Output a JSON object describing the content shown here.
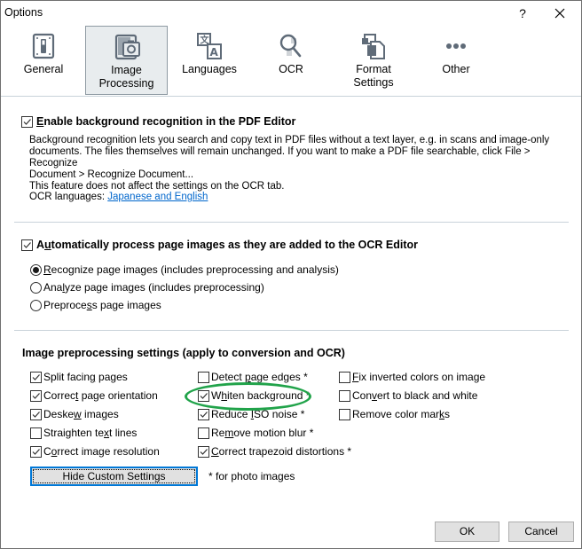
{
  "window": {
    "title": "Options",
    "help_label": "?",
    "close_label": "✕"
  },
  "toolbar": {
    "tabs": [
      {
        "id": "general",
        "label": "General",
        "icon": "switch-icon",
        "selected": false
      },
      {
        "id": "image-processing",
        "label": "Image Processing",
        "icon": "camera-icon",
        "selected": true
      },
      {
        "id": "languages",
        "label": "Languages",
        "icon": "translate-icon",
        "selected": false
      },
      {
        "id": "ocr",
        "label": "OCR",
        "icon": "magnifier-icon",
        "selected": false
      },
      {
        "id": "format-settings",
        "label": "Format Settings",
        "icon": "documents-icon",
        "selected": false
      },
      {
        "id": "other",
        "label": "Other",
        "icon": "more-dots-icon",
        "selected": false
      }
    ],
    "labels": {
      "general": "General",
      "image_processing_1": "Image",
      "image_processing_2": "Processing",
      "languages": "Languages",
      "ocr": "OCR",
      "format_1": "Format",
      "format_2": "Settings",
      "other": "Other"
    }
  },
  "background_recognition": {
    "checked": true,
    "label_mnemonic": "E",
    "label_rest": "nable background recognition in the PDF Editor",
    "desc_line1": "Background recognition lets you search and copy text in PDF files without a text layer, e.g. in scans and image-only",
    "desc_line2": "documents. The files themselves will remain unchanged. If you want to make a PDF file searchable, click File > Recognize",
    "desc_line3": "Document > Recognize Document...",
    "desc_line4": "This feature does not affect the settings on the OCR tab.",
    "ocr_languages_label": "OCR languages:",
    "ocr_languages_value": "Japanese and English"
  },
  "auto_process": {
    "checked": true,
    "label_a": "A",
    "label_mnemonic": "u",
    "label_rest": "tomatically process page images as they are added to the OCR Editor",
    "options": [
      {
        "pre": "",
        "mn": "R",
        "post": "ecognize page images (includes preprocessing and analysis)",
        "selected": true
      },
      {
        "pre": "Ana",
        "mn": "l",
        "post": "yze page images (includes preprocessing)",
        "selected": false
      },
      {
        "pre": "Preproce",
        "mn": "s",
        "post": "s page images",
        "selected": false
      }
    ]
  },
  "preprocessing": {
    "heading": "Image preprocessing settings (apply to conversion and OCR)",
    "col1": [
      {
        "pre": "Split facin",
        "mn": "g",
        "post": " pages",
        "checked": true
      },
      {
        "pre": "Correc",
        "mn": "t",
        "post": " page orientation",
        "checked": true
      },
      {
        "pre": "Deske",
        "mn": "w",
        "post": " images",
        "checked": true
      },
      {
        "pre": "Straighten te",
        "mn": "x",
        "post": "t lines",
        "checked": false
      },
      {
        "pre": "C",
        "mn": "o",
        "post": "rrect image resolution",
        "checked": true
      }
    ],
    "col2": [
      {
        "pre": "Detect ",
        "mn": "p",
        "post": "age edges *",
        "checked": false
      },
      {
        "pre": "W",
        "mn": "h",
        "post": "iten background *",
        "checked": true
      },
      {
        "pre": "Reduce ",
        "mn": "I",
        "post": "SO noise *",
        "checked": true
      },
      {
        "pre": "Re",
        "mn": "m",
        "post": "ove motion blur *",
        "checked": false
      },
      {
        "pre": "",
        "mn": "C",
        "post": "orrect trapezoid distortions *",
        "checked": true
      }
    ],
    "col3": [
      {
        "pre": "",
        "mn": "F",
        "post": "ix inverted colors on image",
        "checked": false
      },
      {
        "pre": "Con",
        "mn": "v",
        "post": "ert to black and white",
        "checked": false
      },
      {
        "pre": "Remove color mar",
        "mn": "k",
        "post": "s",
        "checked": false
      }
    ],
    "hide_button": "Hide Custom Settings",
    "footnote": "* for photo images"
  },
  "footer": {
    "ok_label": "OK",
    "cancel_label": "Cancel"
  },
  "annotation": {
    "highlight_color": "#21a34a",
    "highlighted_item": "Whiten background *"
  }
}
